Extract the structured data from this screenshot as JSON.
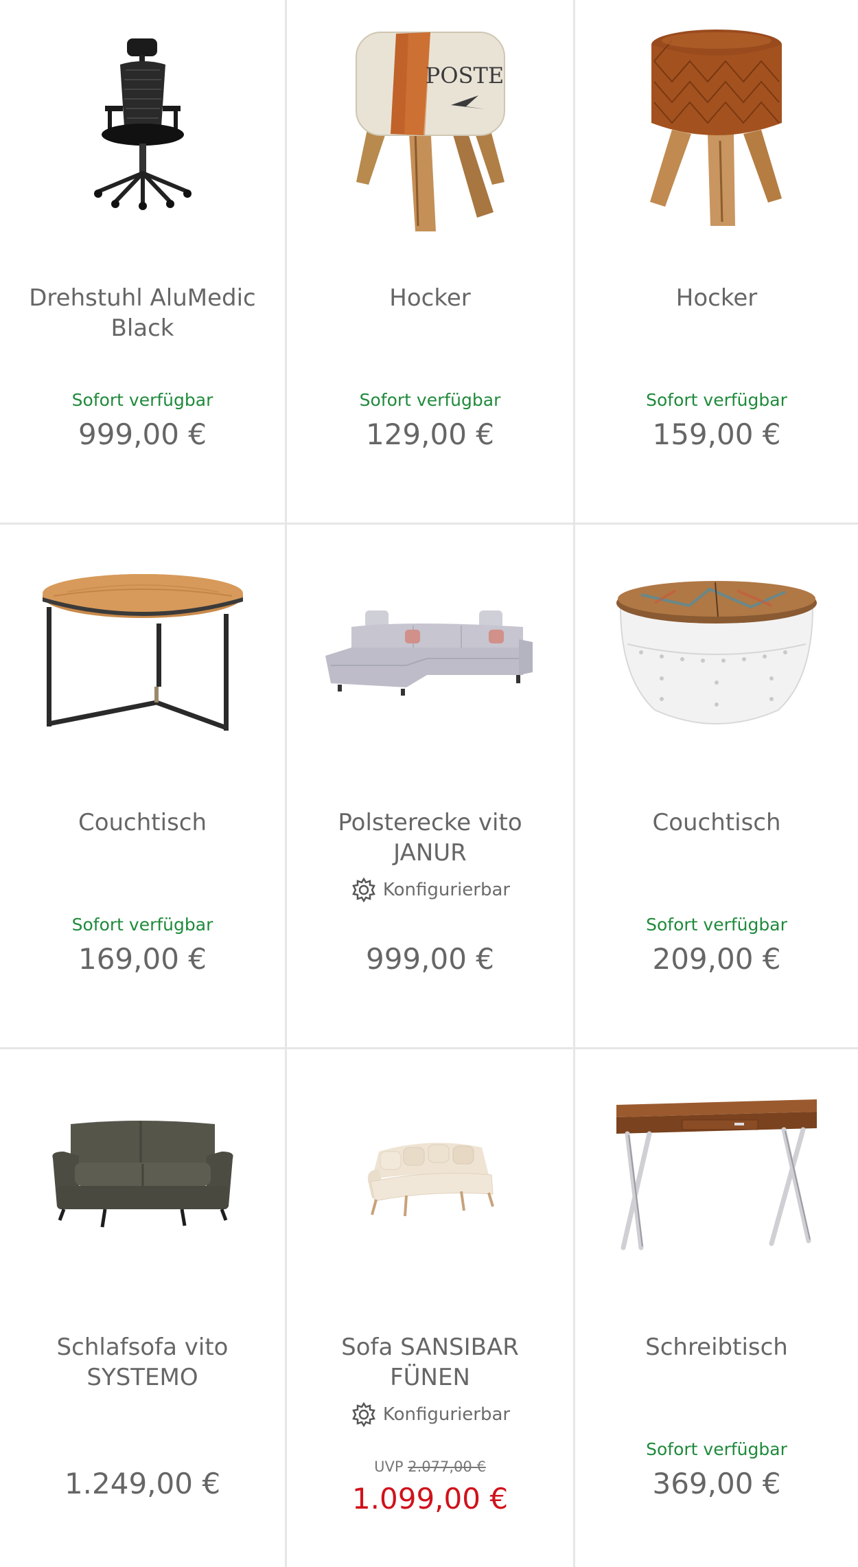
{
  "products": [
    {
      "title": "Drehstuhl AluMedic Black",
      "availability": "Sofort verfügbar",
      "price": "999,00 €",
      "image_icon": "office-chair-image"
    },
    {
      "title": "Hocker",
      "availability": "Sofort verfügbar",
      "price": "129,00 €",
      "image_icon": "poste-stool-image",
      "image_text": "POSTE"
    },
    {
      "title": "Hocker",
      "availability": "Sofort verfügbar",
      "price": "159,00 €",
      "image_icon": "leather-stool-image"
    },
    {
      "title": "Couchtisch",
      "availability": "Sofort verfügbar",
      "price": "169,00 €",
      "image_icon": "round-coffee-table-image"
    },
    {
      "title": "Polsterecke vito JANUR",
      "config_label": "Konfigurierbar",
      "price": "999,00 €",
      "image_icon": "corner-sofa-image"
    },
    {
      "title": "Couchtisch",
      "availability": "Sofort verfügbar",
      "price": "209,00 €",
      "image_icon": "drum-coffee-table-image"
    },
    {
      "title": "Schlafsofa vito SYSTEMO",
      "price": "1.249,00 €",
      "image_icon": "sleeper-sofa-image"
    },
    {
      "title": "Sofa SANSIBAR FÜNEN",
      "config_label": "Konfigurierbar",
      "uvp_label": "UVP",
      "uvp_price": "2.077,00 €",
      "price": "1.099,00 €",
      "image_icon": "curved-sofa-image"
    },
    {
      "title": "Schreibtisch",
      "availability": "Sofort verfügbar",
      "price": "369,00 €",
      "image_icon": "desk-image"
    }
  ],
  "colors": {
    "availability_green": "#1f8a3b",
    "sale_red": "#d0121b",
    "text_gray": "#666666",
    "divider": "#e6e6e6"
  }
}
